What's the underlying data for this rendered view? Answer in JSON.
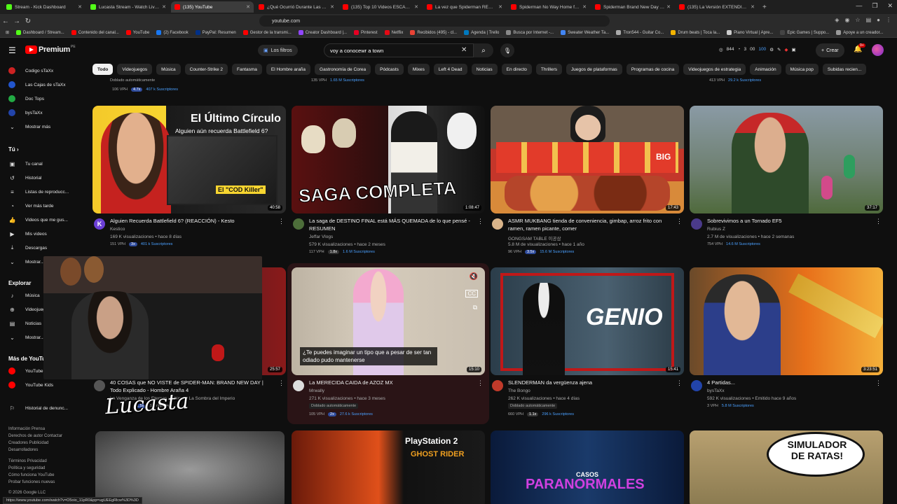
{
  "browser": {
    "tabs": [
      {
        "title": "Stream - Kick Dashboard",
        "color": "#53fc18",
        "active": false
      },
      {
        "title": "Lucasta Stream - Watch Live on Kick",
        "color": "#53fc18",
        "active": false
      },
      {
        "title": "(135) YouTube",
        "color": "#ff0000",
        "active": true
      },
      {
        "title": "¿Qué Ocurrió Durante Las Primeras 24...",
        "color": "#ff0000",
        "active": false
      },
      {
        "title": "(135) Top 10 Videos ESCALOFRIANTES...",
        "color": "#ff0000",
        "active": false
      },
      {
        "title": "La vez que Spiderman REGALÓ un ex...",
        "color": "#ff0000",
        "active": false
      },
      {
        "title": "Spiderman No Way Home fue FAN SE...",
        "color": "#ff0000",
        "active": false
      },
      {
        "title": "Spiderman Brand New Day - ORNIG...",
        "color": "#ff0000",
        "active": false
      },
      {
        "title": "(135) La Versión EXTENDIDA De los T...",
        "color": "#ff0000",
        "active": false
      }
    ],
    "url": "youtube.com",
    "bookmarks": [
      {
        "label": "Dashboard / Stream...",
        "color": "#53fc18"
      },
      {
        "label": "Contenido del canal...",
        "color": "#ff0000"
      },
      {
        "label": "YouTube",
        "color": "#ff0000"
      },
      {
        "label": "(2) Facebook",
        "color": "#1877f2"
      },
      {
        "label": "PayPal: Resumen",
        "color": "#003087"
      },
      {
        "label": "Gestor de la transmi...",
        "color": "#ff0000"
      },
      {
        "label": "Creator Dashboard |...",
        "color": "#9146ff"
      },
      {
        "label": "Pinterest",
        "color": "#e60023"
      },
      {
        "label": "Netflix",
        "color": "#e50914"
      },
      {
        "label": "Recibidos (495) - cl...",
        "color": "#ea4335"
      },
      {
        "label": "Agenda | Trello",
        "color": "#0079bf"
      },
      {
        "label": "Busca por Internet -...",
        "color": "#888888"
      },
      {
        "label": "Sweater Weather Ta...",
        "color": "#4285f4"
      },
      {
        "label": "Tron544 - Guitar Co...",
        "color": "#aaaaaa"
      },
      {
        "label": "Drum beats | Toca la...",
        "color": "#f4b400"
      },
      {
        "label": "Piano Virtual | Apre...",
        "color": "#cccccc"
      },
      {
        "label": "Epic Games | Suppo...",
        "color": "#444444"
      },
      {
        "label": "Apoye a un creador...",
        "color": "#999999"
      }
    ]
  },
  "header": {
    "logo_text": "Premium",
    "country": "PE",
    "filter_chip": "Los filtros",
    "search_value": "voy a conocewr a town",
    "stats": [
      "844",
      "3",
      "00",
      "100"
    ],
    "create_label": "Crear",
    "notif_count": "9+"
  },
  "chips": [
    "Todo",
    "Videojuegos",
    "Música",
    "Counter-Strike 2",
    "Fantasma",
    "El Hombre araña",
    "Gastronomía de Corea",
    "Pódcasts",
    "Mixes",
    "Left 4 Dead",
    "Noticias",
    "En directo",
    "Thrillers",
    "Juegos de plataformas",
    "Programas de cocina",
    "Videojuegos de estrategia",
    "Animación",
    "Música pop",
    "Subidas recien..."
  ],
  "sidebar": {
    "subs": [
      {
        "label": "Codigo sTaXx",
        "color": "#cc2222"
      },
      {
        "label": "Las Cajas de sTaXx",
        "color": "#2255cc"
      },
      {
        "label": "Doc Tops",
        "color": "#22aa44"
      },
      {
        "label": "bysTaXx",
        "color": "#2244aa"
      }
    ],
    "show_more": "Mostrar más",
    "you_title": "Tú",
    "you_items": [
      "Tu canal",
      "Historial",
      "Listas de reproducc...",
      "Ver más tarde",
      "Videos que me gus...",
      "Mis videos",
      "Descargas",
      "Mostrar..."
    ],
    "explore_title": "Explorar",
    "explore_items": [
      "Música",
      "Videojuegos",
      "Noticias",
      "Mostrar..."
    ],
    "more_title": "Más de YouTube",
    "more_items": [
      "YouTube",
      "YouTube Kids"
    ],
    "report": "Historial de denunc...",
    "footer1": "Información  Prensa\nDerechos de autor  Contactar\nCreadores  Publicidad\nDesarrolladores",
    "footer2": "Términos  Privacidad\nPolítica y seguridad\nCómo funciona YouTube\nProbar funciones nuevas",
    "copyright": "© 2026 Google LLC"
  },
  "top_partial": {
    "a_stats": [
      "106 VPH",
      "4.7x",
      "407 k Suscriptores"
    ],
    "a_dubbed": "Doblado automáticamente",
    "b_stats": [
      "135 VPH",
      "1.65 M Suscriptores"
    ],
    "c_stats": [
      "413 VPH",
      "29.2 k Suscriptores"
    ]
  },
  "videos": [
    {
      "title": "Alguien Recuerda Battlefield 6? (REACCIÓN) - Kesto",
      "channel": "Kestico",
      "meta": "169 K visualizaciones • hace 8 días",
      "stats": [
        "151 VPH",
        "3x",
        "401 k Suscriptores"
      ],
      "duration": "40:58",
      "thumb_text1": "El Último Círculo",
      "thumb_text2": "Alguien aún recuerda Battlefield 6?",
      "thumb_text3": "El \"COD Killer\"",
      "avatar_letter": "K"
    },
    {
      "title": "La saga de DESTINO FINAL está MÁS QUEMADA de lo que pensé - RESUMEN",
      "channel": "Jeffar Vlogs",
      "meta": "579 K visualizaciones • hace 2 meses",
      "stats": [
        "117 VPH",
        "1.8x",
        "1.6 M Suscriptores"
      ],
      "duration": "1:08:47",
      "thumb_text1": "SAGA COMPLETA"
    },
    {
      "title": "ASMR MUKBANG tienda de conveniencia, gimbap, arroz frito con ramen, ramen picante, comer",
      "channel": "GONGSAM TABLE 이공삼",
      "meta": "5.8 M de visualizaciones • hace 1 año",
      "stats": [
        "96 VPH",
        "3.5x",
        "15.6 M Suscriptores"
      ],
      "duration": "17:43",
      "thumb_text1": "BIG"
    },
    {
      "title": "Sobrevivimos a un Tornado EF5",
      "channel": "Rubius Z",
      "meta": "2.7 M de visualizaciones • hace 2 semanas",
      "stats": [
        "754 VPH",
        "14.6 M Suscriptores"
      ],
      "duration": "37:17"
    },
    {
      "title": "40 COSAS que NO VISTE de SPIDER-MAN: BRAND NEW DAY | Todo Explicado - Hombre Araña 4",
      "channel": "La Venganza de los Eternos • Shimp y La Sombra del Imperio",
      "meta": "",
      "stats": [
        "1.5x",
        "Suscriptores"
      ],
      "duration": "25:57"
    },
    {
      "title": "La MERECIDA CAIDA de AZOZ MX",
      "channel": "Mrwally",
      "meta": "271 K visualizaciones • hace 3 meses",
      "dubbed": "Doblado automáticamente",
      "stats": [
        "105 VPH",
        "2x",
        "27.6 k Suscriptores"
      ],
      "duration": "15:10",
      "caption": "¿Te puedes imaginar un tipo que a pesar de ser tan odiado pudo mantenerse"
    },
    {
      "title": "SLENDERMAN da vergüenza ajena",
      "channel": "The Bongo",
      "meta": "262 K visualizaciones • hace 4 días",
      "dubbed": "Doblado automáticamente",
      "stats": [
        "660 VPH",
        "1.1x",
        "296 k Suscriptores"
      ],
      "duration": "15:41",
      "thumb_text1": "GENIO"
    },
    {
      "title": "4 Partidas...",
      "channel": "bysTaXx",
      "meta": "592 K visualizaciones • Emitido hace 9 años",
      "stats": [
        "3 VPH",
        "5.8 M Suscriptores"
      ],
      "duration": "3:23:51"
    }
  ],
  "bottom_row": {
    "b_text": "PlayStation 2",
    "b_text2": "GHOST RIDER",
    "c_text": "CASOS",
    "c_text2": "PARANORMALES",
    "d_text": "SIMULADOR DE RATAS!"
  },
  "overlay": {
    "streamer_name": "Lucasta",
    "status_url": "https://www.youtube.com/watch?v=O5oio_11pR0&pp=ugUEEgRlcw%3D%3D"
  }
}
